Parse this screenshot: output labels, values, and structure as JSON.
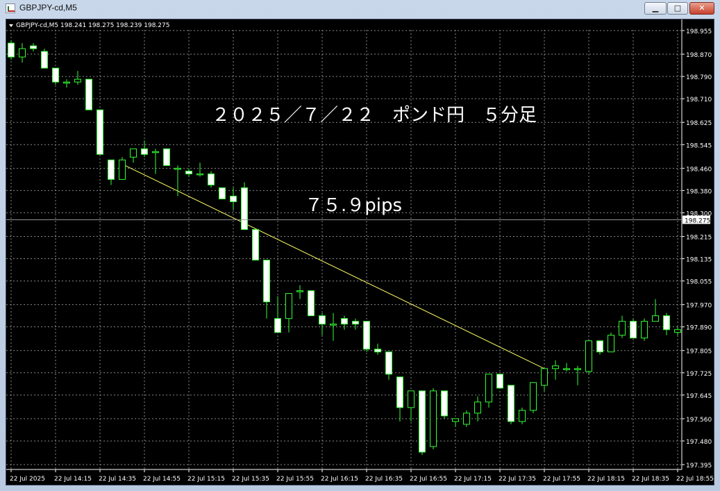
{
  "window": {
    "title": "GBPJPY-cd,M5",
    "buttons": {
      "minimize": "▁",
      "maximize": "□",
      "close": "✕"
    }
  },
  "chart_data": {
    "type": "candlestick",
    "header": "GBPJPY-cd,M5  198.241 198.275 198.239 198.275",
    "annotations": [
      "２０２５／７／２２　ポンド円　５分足",
      "７５.９pips"
    ],
    "current_price": 198.275,
    "y_ticks": [
      198.955,
      198.87,
      198.79,
      198.71,
      198.625,
      198.545,
      198.46,
      198.38,
      198.3,
      198.215,
      198.135,
      198.055,
      197.97,
      197.89,
      197.805,
      197.725,
      197.645,
      197.56,
      197.48,
      197.395
    ],
    "ylim": [
      197.395,
      198.955
    ],
    "x_labels": [
      "22 Jul 2025",
      "22 Jul 14:15",
      "22 Jul 14:35",
      "22 Jul 14:55",
      "22 Jul 15:15",
      "22 Jul 15:35",
      "22 Jul 15:55",
      "22 Jul 16:15",
      "22 Jul 16:35",
      "22 Jul 16:55",
      "22 Jul 17:15",
      "22 Jul 17:35",
      "22 Jul 17:55",
      "22 Jul 18:15",
      "22 Jul 18:35",
      "22 Jul 18:55"
    ],
    "trendline": {
      "start_bar": 10,
      "start_price": 198.475,
      "end_bar": 48,
      "end_price": 197.74
    },
    "candles": [
      [
        198.91,
        198.92,
        198.85,
        198.86
      ],
      [
        198.86,
        198.91,
        198.84,
        198.89
      ],
      [
        198.9,
        198.91,
        198.88,
        198.89
      ],
      [
        198.88,
        198.89,
        198.82,
        198.82
      ],
      [
        198.82,
        198.82,
        198.76,
        198.77
      ],
      [
        198.77,
        198.78,
        198.75,
        198.77
      ],
      [
        198.77,
        198.81,
        198.76,
        198.78
      ],
      [
        198.78,
        198.78,
        198.67,
        198.67
      ],
      [
        198.67,
        198.67,
        198.51,
        198.51
      ],
      [
        198.49,
        198.49,
        198.4,
        198.42
      ],
      [
        198.42,
        198.5,
        198.42,
        198.49
      ],
      [
        198.5,
        198.53,
        198.48,
        198.53
      ],
      [
        198.53,
        198.56,
        198.5,
        198.51
      ],
      [
        198.52,
        198.53,
        198.44,
        198.52
      ],
      [
        198.53,
        198.53,
        198.47,
        198.47
      ],
      [
        198.46,
        198.47,
        198.36,
        198.46
      ],
      [
        198.45,
        198.46,
        198.43,
        198.44
      ],
      [
        198.44,
        198.48,
        198.43,
        198.44
      ],
      [
        198.44,
        198.45,
        198.39,
        198.4
      ],
      [
        198.39,
        198.39,
        198.35,
        198.35
      ],
      [
        198.36,
        198.39,
        198.31,
        198.34
      ],
      [
        198.39,
        198.41,
        198.26,
        198.24
      ],
      [
        198.24,
        198.24,
        198.13,
        198.13
      ],
      [
        198.13,
        198.13,
        197.92,
        197.98
      ],
      [
        197.92,
        198.0,
        197.87,
        197.87
      ],
      [
        197.92,
        198.01,
        197.87,
        198.01
      ],
      [
        198.02,
        198.04,
        197.99,
        198.02
      ],
      [
        198.02,
        198.02,
        197.93,
        197.93
      ],
      [
        197.93,
        197.94,
        197.86,
        197.9
      ],
      [
        197.9,
        197.94,
        197.84,
        197.9
      ],
      [
        197.92,
        197.93,
        197.88,
        197.9
      ],
      [
        197.91,
        197.92,
        197.88,
        197.9
      ],
      [
        197.91,
        197.91,
        197.8,
        197.81
      ],
      [
        197.81,
        197.83,
        197.79,
        197.8
      ],
      [
        197.8,
        197.8,
        197.7,
        197.72
      ],
      [
        197.71,
        197.71,
        197.55,
        197.6
      ],
      [
        197.6,
        197.66,
        197.55,
        197.66
      ],
      [
        197.66,
        197.66,
        197.43,
        197.44
      ],
      [
        197.46,
        197.67,
        197.45,
        197.66
      ],
      [
        197.66,
        197.66,
        197.56,
        197.57
      ],
      [
        197.55,
        197.56,
        197.53,
        197.56
      ],
      [
        197.54,
        197.59,
        197.53,
        197.58
      ],
      [
        197.58,
        197.64,
        197.55,
        197.62
      ],
      [
        197.62,
        197.72,
        197.6,
        197.72
      ],
      [
        197.72,
        197.72,
        197.67,
        197.67
      ],
      [
        197.68,
        197.68,
        197.54,
        197.55
      ],
      [
        197.55,
        197.6,
        197.54,
        197.59
      ],
      [
        197.59,
        197.69,
        197.58,
        197.69
      ],
      [
        197.68,
        197.74,
        197.66,
        197.74
      ],
      [
        197.74,
        197.77,
        197.7,
        197.75
      ],
      [
        197.74,
        197.76,
        197.73,
        197.74
      ],
      [
        197.74,
        197.75,
        197.68,
        197.74
      ],
      [
        197.73,
        197.76,
        197.72,
        197.84
      ],
      [
        197.84,
        197.84,
        197.79,
        197.8
      ],
      [
        197.8,
        197.87,
        197.8,
        197.86
      ],
      [
        197.86,
        197.93,
        197.85,
        197.91
      ],
      [
        197.91,
        197.92,
        197.85,
        197.85
      ],
      [
        197.85,
        197.92,
        197.84,
        197.91
      ],
      [
        197.91,
        197.99,
        197.91,
        197.93
      ],
      [
        197.93,
        197.94,
        197.86,
        197.88
      ],
      [
        197.87,
        197.89,
        197.86,
        197.88
      ]
    ]
  }
}
